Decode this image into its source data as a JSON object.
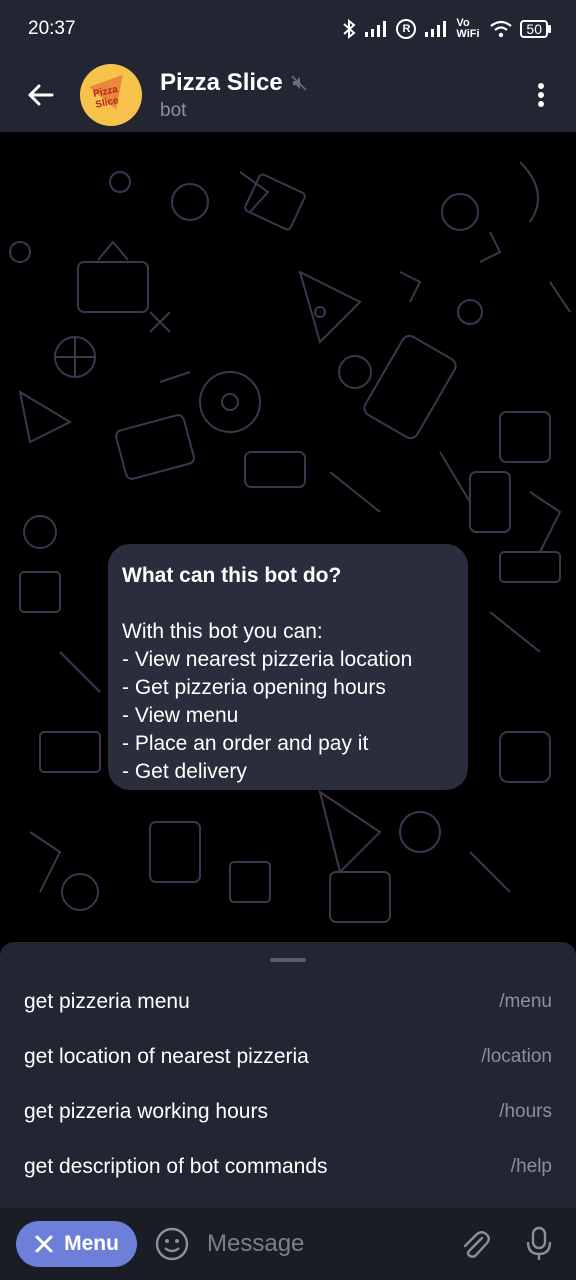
{
  "status_bar": {
    "time": "20:37",
    "r_label": "R",
    "volte_label": "Vo WiFi",
    "battery": "50"
  },
  "header": {
    "title": "Pizza Slice",
    "subtitle": "bot",
    "avatar_text": "Pizza Slice"
  },
  "bubble": {
    "title": "What can this bot do?",
    "intro": "With this bot you can:",
    "items": [
      "- View nearest pizzeria location",
      "- Get pizzeria opening hours",
      "- View menu",
      "- Place an order and pay it",
      "- Get delivery"
    ]
  },
  "commands": [
    {
      "description": "get pizzeria menu",
      "command": "/menu"
    },
    {
      "description": "get location of nearest pizzeria",
      "command": "/location"
    },
    {
      "description": "get pizzeria working hours",
      "command": "/hours"
    },
    {
      "description": "get description of bot commands",
      "command": "/help"
    }
  ],
  "input_bar": {
    "menu_label": "Menu",
    "placeholder": "Message"
  },
  "colors": {
    "header_bg": "#232532",
    "bubble_bg": "#2a2d3b",
    "accent": "#6d7fd9",
    "muted_text": "#8b8f9c"
  }
}
